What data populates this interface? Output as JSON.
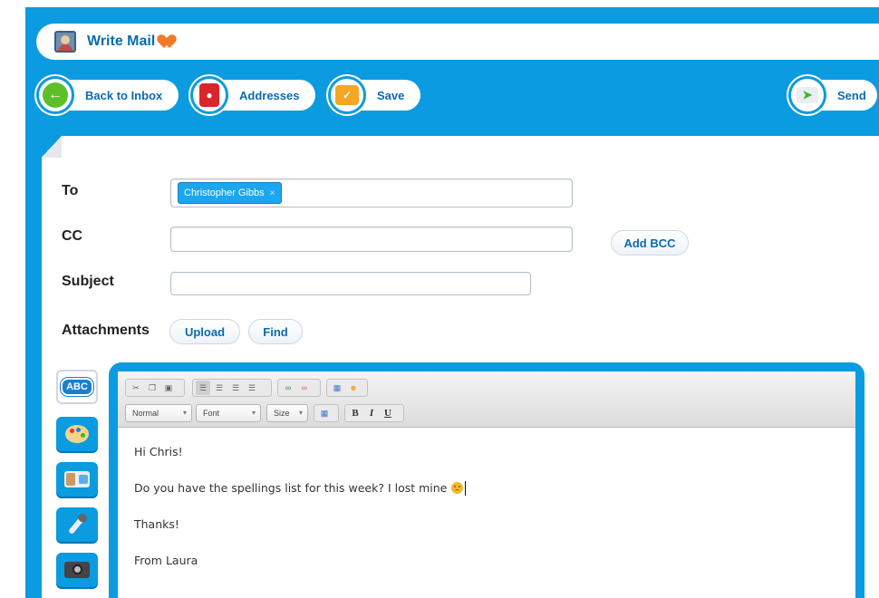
{
  "window": {
    "title": "Write Mail"
  },
  "toolbar": {
    "back_label": "Back to Inbox",
    "addresses_label": "Addresses",
    "save_label": "Save",
    "send_label": "Send"
  },
  "form": {
    "to_label": "To",
    "to_recipient": "Christopher Gibbs",
    "to_remove_glyph": "×",
    "cc_label": "CC",
    "cc_value": "",
    "subject_label": "Subject",
    "subject_value": "",
    "add_bcc_label": "Add BCC",
    "attachments_label": "Attachments",
    "upload_label": "Upload",
    "find_label": "Find"
  },
  "tools": {
    "spellcheck_label": "ABC",
    "items": [
      "abc-icon",
      "palette-icon",
      "video-camera-icon",
      "microphone-icon",
      "camera-icon"
    ]
  },
  "editor": {
    "format_select": "Normal",
    "font_select": "Font",
    "size_select": "Size",
    "bold_label": "B",
    "italic_label": "I",
    "underline_label": "U",
    "body": {
      "line1": "Hi Chris!",
      "line2": "Do you have the spellings list for this week? I lost mine",
      "line3": "Thanks!",
      "line4": "From Laura"
    }
  },
  "colors": {
    "primary_blue": "#0a9be0",
    "chip_blue": "#1ba6ee",
    "label_blue": "#0a6bb0"
  }
}
